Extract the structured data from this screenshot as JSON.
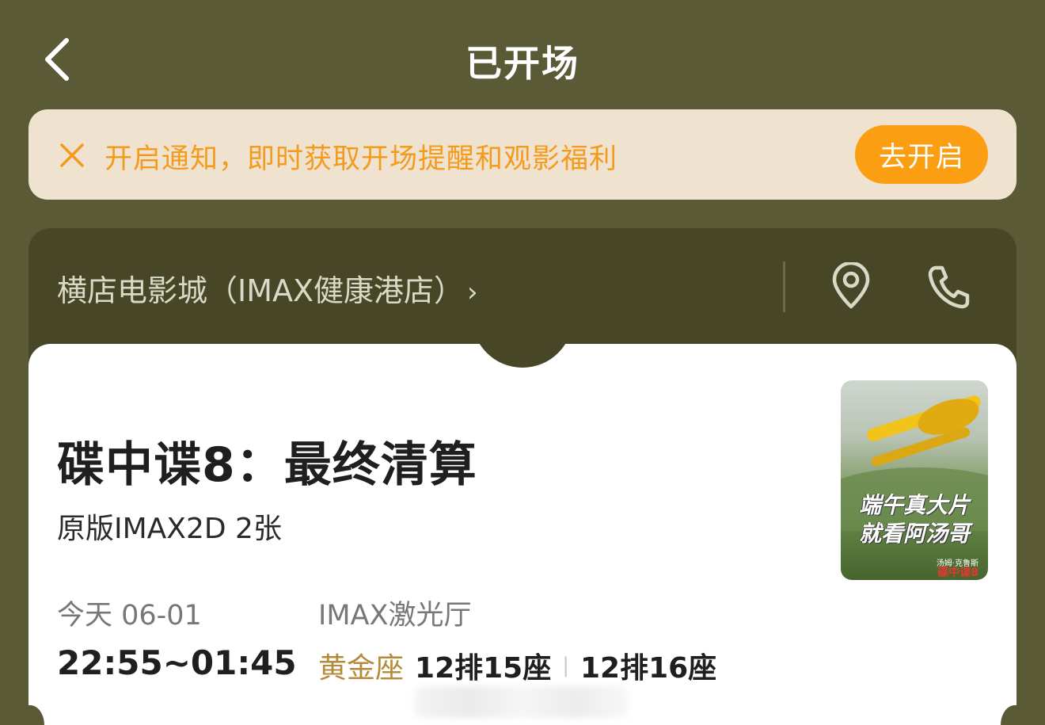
{
  "header": {
    "title": "已开场",
    "back_icon": "chevron-left-icon"
  },
  "notice": {
    "close_icon": "close-icon",
    "text": "开启通知，即时获取开场提醒和观影福利",
    "button_label": "去开启",
    "text_color": "#f49a1c",
    "button_color": "#fb9e12"
  },
  "cinema": {
    "name": "横店电影城（IMAX健康港店）",
    "chevron": "›",
    "location_icon": "map-pin-icon",
    "phone_icon": "phone-icon"
  },
  "ticket": {
    "movie_title": "碟中谍8：最终清算",
    "format": "原版IMAX2D 2张",
    "date": "今天 06-01",
    "time": "22:55~01:45",
    "hall": "IMAX激光厅",
    "seat_type": "黄金座",
    "seats": [
      "12排15座",
      "12排16座"
    ],
    "seat_separator": "|",
    "seat_type_color": "#b58a3a"
  },
  "poster": {
    "line1": "端午真大片",
    "line2": "就看阿汤哥",
    "small_text": "汤姆·克鲁斯",
    "brand": "碟中谍8"
  }
}
